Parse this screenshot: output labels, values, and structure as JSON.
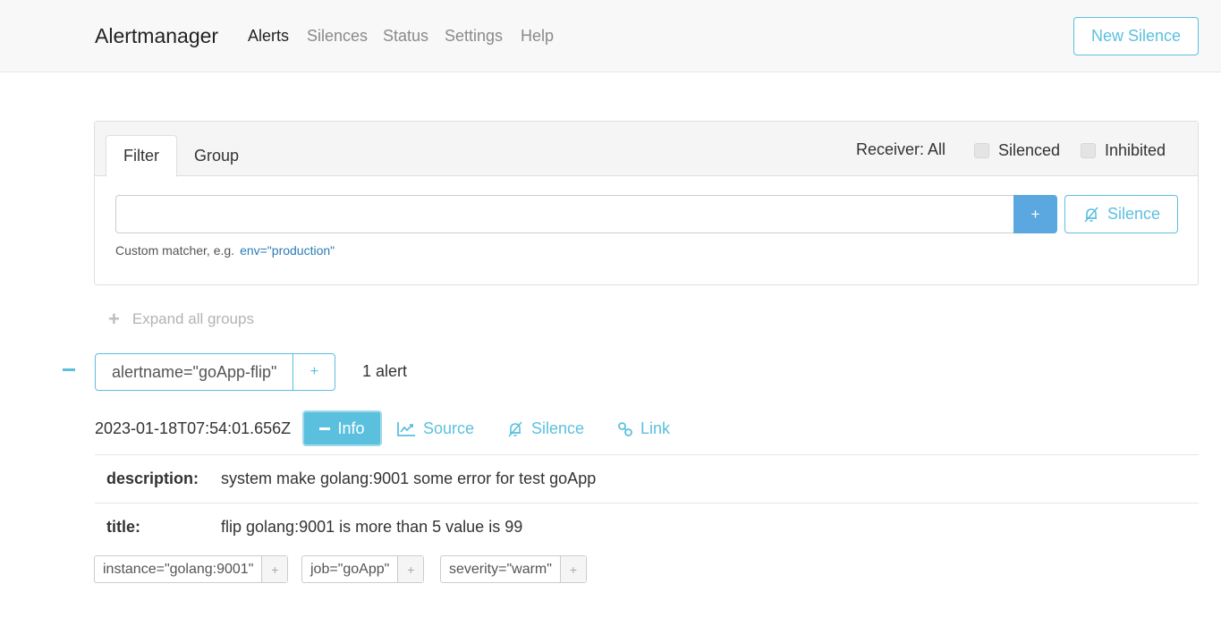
{
  "navbar": {
    "brand": "Alertmanager",
    "items": [
      {
        "label": "Alerts",
        "active": true
      },
      {
        "label": "Silences",
        "active": false
      },
      {
        "label": "Status",
        "active": false
      },
      {
        "label": "Settings",
        "active": false
      },
      {
        "label": "Help",
        "active": false
      }
    ],
    "new_silence": "New Silence"
  },
  "filter_card": {
    "tabs": [
      "Filter",
      "Group"
    ],
    "active_tab": "Filter",
    "receiver": "Receiver: All",
    "checkboxes": [
      {
        "label": "Silenced",
        "checked": false
      },
      {
        "label": "Inhibited",
        "checked": false
      }
    ],
    "input_value": "",
    "plus_label": "+",
    "silence_label": "Silence",
    "hint_text": "Custom matcher, e.g.",
    "hint_example": "env=\"production\""
  },
  "expand_all": "Expand all groups",
  "group": {
    "label": "alertname=\"goApp-flip\"",
    "plus": "+",
    "count": "1 alert"
  },
  "alert": {
    "timestamp": "2023-01-18T07:54:01.656Z",
    "info_label": "Info",
    "source_label": "Source",
    "silence_label": "Silence",
    "link_label": "Link",
    "annotations": [
      {
        "key": "description:",
        "value": "system make golang:9001 some error for test goApp"
      },
      {
        "key": "title:",
        "value": "flip golang:9001 is more than 5 value is 99"
      }
    ],
    "labels": [
      {
        "text": "instance=\"golang:9001\"",
        "plus": "+"
      },
      {
        "text": "job=\"goApp\"",
        "plus": "+"
      },
      {
        "text": "severity=\"warm\"",
        "plus": "+"
      }
    ]
  },
  "colors": {
    "accent": "#5bc0de",
    "primary": "#5ba8e0"
  }
}
